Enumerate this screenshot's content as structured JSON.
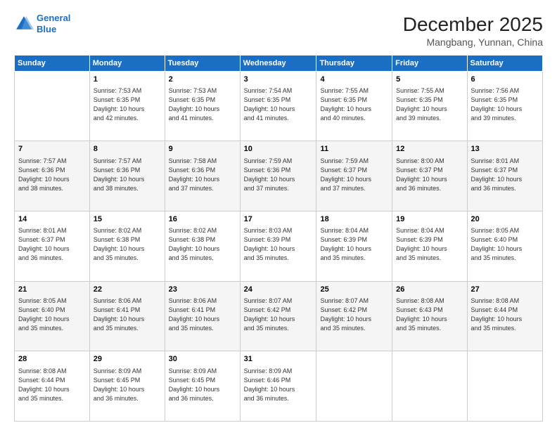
{
  "header": {
    "logo_line1": "General",
    "logo_line2": "Blue",
    "title": "December 2025",
    "subtitle": "Mangbang, Yunnan, China"
  },
  "calendar": {
    "days_of_week": [
      "Sunday",
      "Monday",
      "Tuesday",
      "Wednesday",
      "Thursday",
      "Friday",
      "Saturday"
    ],
    "weeks": [
      [
        {
          "day": "",
          "info": ""
        },
        {
          "day": "1",
          "info": "Sunrise: 7:53 AM\nSunset: 6:35 PM\nDaylight: 10 hours\nand 42 minutes."
        },
        {
          "day": "2",
          "info": "Sunrise: 7:53 AM\nSunset: 6:35 PM\nDaylight: 10 hours\nand 41 minutes."
        },
        {
          "day": "3",
          "info": "Sunrise: 7:54 AM\nSunset: 6:35 PM\nDaylight: 10 hours\nand 41 minutes."
        },
        {
          "day": "4",
          "info": "Sunrise: 7:55 AM\nSunset: 6:35 PM\nDaylight: 10 hours\nand 40 minutes."
        },
        {
          "day": "5",
          "info": "Sunrise: 7:55 AM\nSunset: 6:35 PM\nDaylight: 10 hours\nand 39 minutes."
        },
        {
          "day": "6",
          "info": "Sunrise: 7:56 AM\nSunset: 6:35 PM\nDaylight: 10 hours\nand 39 minutes."
        }
      ],
      [
        {
          "day": "7",
          "info": "Sunrise: 7:57 AM\nSunset: 6:36 PM\nDaylight: 10 hours\nand 38 minutes."
        },
        {
          "day": "8",
          "info": "Sunrise: 7:57 AM\nSunset: 6:36 PM\nDaylight: 10 hours\nand 38 minutes."
        },
        {
          "day": "9",
          "info": "Sunrise: 7:58 AM\nSunset: 6:36 PM\nDaylight: 10 hours\nand 37 minutes."
        },
        {
          "day": "10",
          "info": "Sunrise: 7:59 AM\nSunset: 6:36 PM\nDaylight: 10 hours\nand 37 minutes."
        },
        {
          "day": "11",
          "info": "Sunrise: 7:59 AM\nSunset: 6:37 PM\nDaylight: 10 hours\nand 37 minutes."
        },
        {
          "day": "12",
          "info": "Sunrise: 8:00 AM\nSunset: 6:37 PM\nDaylight: 10 hours\nand 36 minutes."
        },
        {
          "day": "13",
          "info": "Sunrise: 8:01 AM\nSunset: 6:37 PM\nDaylight: 10 hours\nand 36 minutes."
        }
      ],
      [
        {
          "day": "14",
          "info": "Sunrise: 8:01 AM\nSunset: 6:37 PM\nDaylight: 10 hours\nand 36 minutes."
        },
        {
          "day": "15",
          "info": "Sunrise: 8:02 AM\nSunset: 6:38 PM\nDaylight: 10 hours\nand 35 minutes."
        },
        {
          "day": "16",
          "info": "Sunrise: 8:02 AM\nSunset: 6:38 PM\nDaylight: 10 hours\nand 35 minutes."
        },
        {
          "day": "17",
          "info": "Sunrise: 8:03 AM\nSunset: 6:39 PM\nDaylight: 10 hours\nand 35 minutes."
        },
        {
          "day": "18",
          "info": "Sunrise: 8:04 AM\nSunset: 6:39 PM\nDaylight: 10 hours\nand 35 minutes."
        },
        {
          "day": "19",
          "info": "Sunrise: 8:04 AM\nSunset: 6:39 PM\nDaylight: 10 hours\nand 35 minutes."
        },
        {
          "day": "20",
          "info": "Sunrise: 8:05 AM\nSunset: 6:40 PM\nDaylight: 10 hours\nand 35 minutes."
        }
      ],
      [
        {
          "day": "21",
          "info": "Sunrise: 8:05 AM\nSunset: 6:40 PM\nDaylight: 10 hours\nand 35 minutes."
        },
        {
          "day": "22",
          "info": "Sunrise: 8:06 AM\nSunset: 6:41 PM\nDaylight: 10 hours\nand 35 minutes."
        },
        {
          "day": "23",
          "info": "Sunrise: 8:06 AM\nSunset: 6:41 PM\nDaylight: 10 hours\nand 35 minutes."
        },
        {
          "day": "24",
          "info": "Sunrise: 8:07 AM\nSunset: 6:42 PM\nDaylight: 10 hours\nand 35 minutes."
        },
        {
          "day": "25",
          "info": "Sunrise: 8:07 AM\nSunset: 6:42 PM\nDaylight: 10 hours\nand 35 minutes."
        },
        {
          "day": "26",
          "info": "Sunrise: 8:08 AM\nSunset: 6:43 PM\nDaylight: 10 hours\nand 35 minutes."
        },
        {
          "day": "27",
          "info": "Sunrise: 8:08 AM\nSunset: 6:44 PM\nDaylight: 10 hours\nand 35 minutes."
        }
      ],
      [
        {
          "day": "28",
          "info": "Sunrise: 8:08 AM\nSunset: 6:44 PM\nDaylight: 10 hours\nand 35 minutes."
        },
        {
          "day": "29",
          "info": "Sunrise: 8:09 AM\nSunset: 6:45 PM\nDaylight: 10 hours\nand 36 minutes."
        },
        {
          "day": "30",
          "info": "Sunrise: 8:09 AM\nSunset: 6:45 PM\nDaylight: 10 hours\nand 36 minutes."
        },
        {
          "day": "31",
          "info": "Sunrise: 8:09 AM\nSunset: 6:46 PM\nDaylight: 10 hours\nand 36 minutes."
        },
        {
          "day": "",
          "info": ""
        },
        {
          "day": "",
          "info": ""
        },
        {
          "day": "",
          "info": ""
        }
      ]
    ]
  }
}
